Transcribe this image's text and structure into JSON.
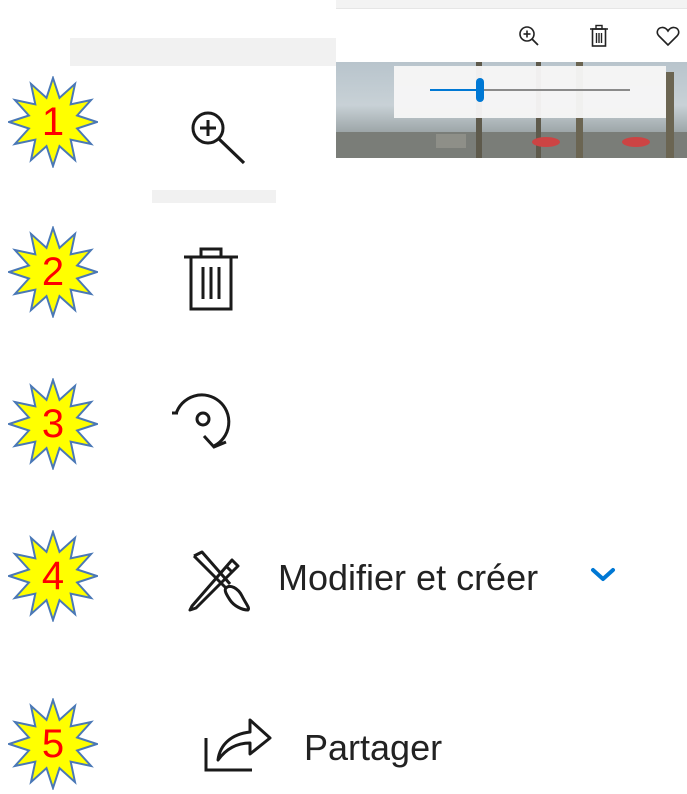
{
  "badges": [
    "1",
    "2",
    "3",
    "4",
    "5"
  ],
  "toolbar_icons": [
    "zoom-in-icon",
    "trash-icon",
    "heart-icon",
    "rotate-icon",
    "edit-create-icon",
    "share-icon"
  ],
  "zoom_slider": {
    "level": 0.25
  },
  "menu": {
    "edit_label": "Modifier et créer",
    "share_label": "Partager"
  },
  "colors": {
    "accent": "#0078d4",
    "badge_fill": "#ffff00",
    "badge_stroke": "#4a78b6",
    "badge_text": "#ff0000"
  }
}
